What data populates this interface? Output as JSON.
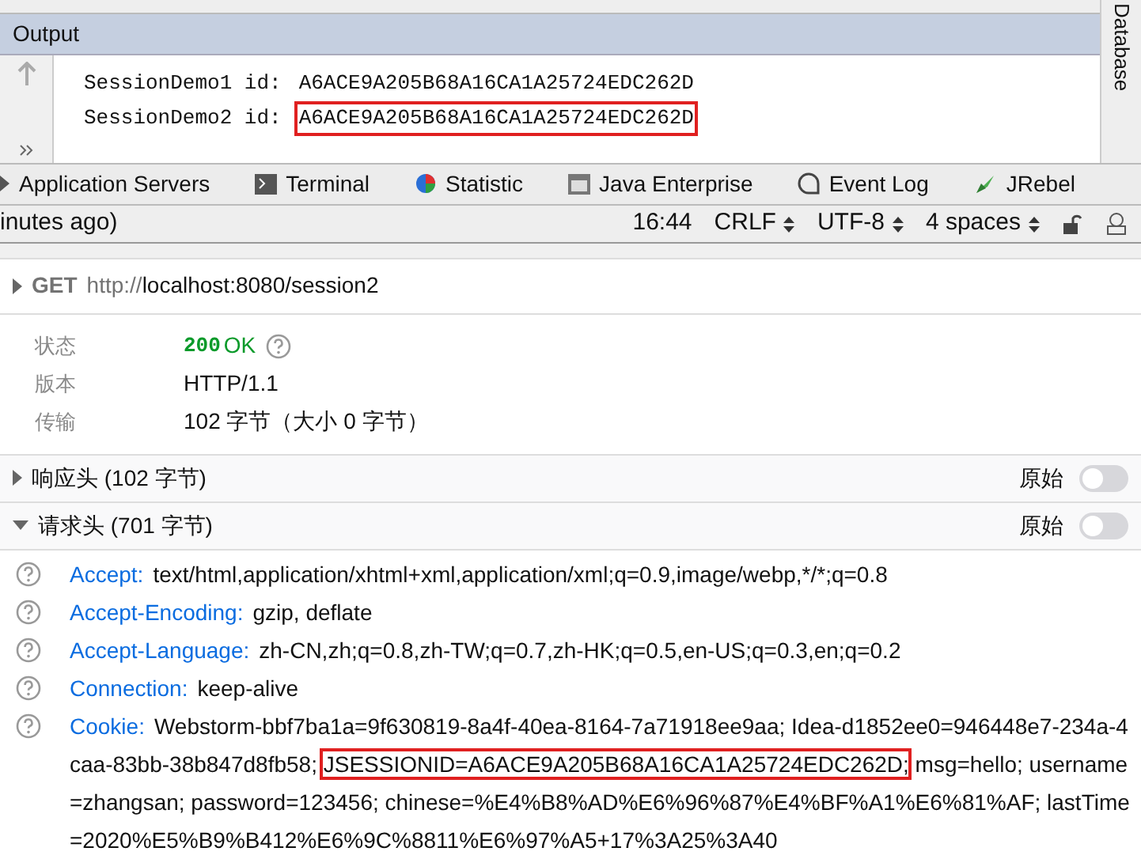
{
  "output": {
    "title": "Output",
    "side_label": "Database",
    "lines": [
      {
        "label": "SessionDemo1 id:",
        "value": "A6ACE9A205B68A16CA1A25724EDC262D",
        "highlighted": false
      },
      {
        "label": "SessionDemo2 id:",
        "value": "A6ACE9A205B68A16CA1A25724EDC262D",
        "highlighted": true
      }
    ]
  },
  "tool_tabs": [
    {
      "label": "Application Servers",
      "kind": "servers"
    },
    {
      "label": "Terminal",
      "kind": "terminal"
    },
    {
      "label": "Statistic",
      "kind": "statistic"
    },
    {
      "label": "Java Enterprise",
      "kind": "enterprise"
    },
    {
      "label": "Event Log",
      "kind": "log"
    },
    {
      "label": "JRebel",
      "kind": "jrebel"
    }
  ],
  "status_bar": {
    "message": "inutes ago)",
    "items": [
      {
        "label": "16:44",
        "kind": "plain"
      },
      {
        "label": "CRLF",
        "kind": "select"
      },
      {
        "label": "UTF-8",
        "kind": "select"
      },
      {
        "label": "4 spaces",
        "kind": "select"
      }
    ]
  },
  "request": {
    "method": "GET",
    "url_prefix": "http://",
    "url_rest": "localhost:8080/session2",
    "expanded": false
  },
  "summary": [
    {
      "label": "状态",
      "kind": "status",
      "code": "200",
      "value": "OK"
    },
    {
      "label": "版本",
      "kind": "text",
      "value": "HTTP/1.1"
    },
    {
      "label": "传输",
      "kind": "text",
      "value": "102 字节（大小 0 字节）"
    }
  ],
  "sections": [
    {
      "title": "响应头 (102 字节)",
      "expanded": false,
      "raw_label": "原始",
      "raw_on": false
    },
    {
      "title": "请求头 (701 字节)",
      "expanded": true,
      "raw_label": "原始",
      "raw_on": false
    }
  ],
  "headers": [
    {
      "name": "Accept:",
      "parts": [
        {
          "text": "text/html,application/xhtml+xml,application/xml;q=0.9,image/webp,*/*;q=0.8",
          "highlighted": false
        }
      ]
    },
    {
      "name": "Accept-Encoding:",
      "parts": [
        {
          "text": "gzip, deflate",
          "highlighted": false
        }
      ]
    },
    {
      "name": "Accept-Language:",
      "parts": [
        {
          "text": "zh-CN,zh;q=0.8,zh-TW;q=0.7,zh-HK;q=0.5,en-US;q=0.3,en;q=0.2",
          "highlighted": false
        }
      ]
    },
    {
      "name": "Connection:",
      "parts": [
        {
          "text": "keep-alive",
          "highlighted": false
        }
      ]
    },
    {
      "name": "Cookie:",
      "parts": [
        {
          "text": "Webstorm-bbf7ba1a=9f630819-8a4f-40ea-8164-7a71918ee9aa; Idea-d1852ee0=946448e7-234a-4caa-83bb-38b847d8fb58; ",
          "highlighted": false
        },
        {
          "text": "JSESSIONID=A6ACE9A205B68A16CA1A25724EDC262D;",
          "highlighted": true
        },
        {
          "text": " msg=hello; username=zhangsan; password=123456; chinese=%E4%B8%AD%E6%96%87%E4%BF%A1%E6%81%AF; lastTime=2020%E5%B9%B412%E6%9C%8811%E6%97%A5+17%3A25%3A40",
          "highlighted": false
        }
      ]
    }
  ]
}
